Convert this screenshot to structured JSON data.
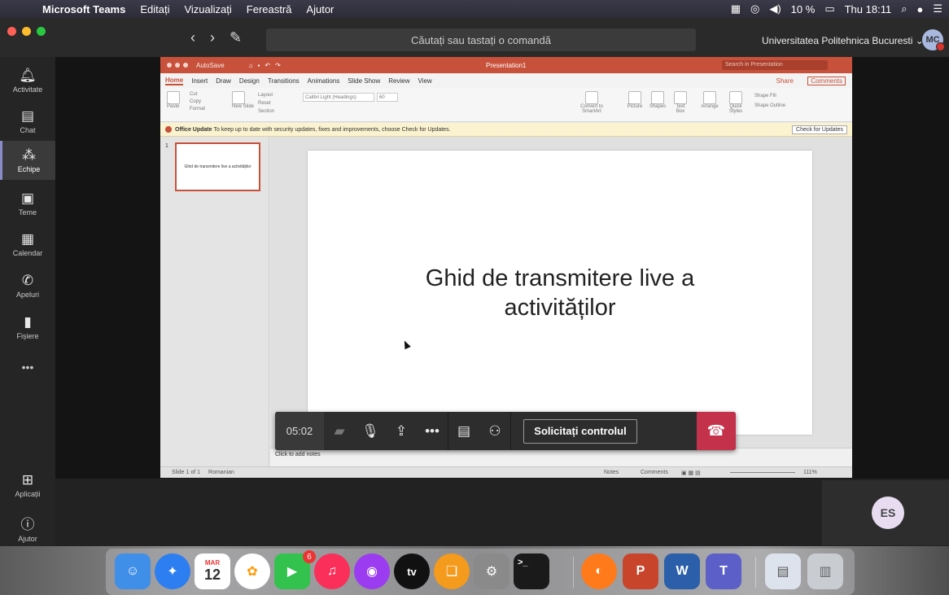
{
  "menubar": {
    "app": "Microsoft Teams",
    "items": [
      "Editați",
      "Vizualizați",
      "Fereastră",
      "Ajutor"
    ],
    "battery": "10 %",
    "clock": "Thu 18:11"
  },
  "titlebar": {
    "search_placeholder": "Căutați sau tastați o comandă",
    "org": "Universitatea Politehnica Bucuresti ⌄",
    "avatar": "MC"
  },
  "rail": {
    "items": [
      {
        "label": "Activitate",
        "icon": "bell-icon"
      },
      {
        "label": "Chat",
        "icon": "chat-icon"
      },
      {
        "label": "Echipe",
        "icon": "teams-icon"
      },
      {
        "label": "Teme",
        "icon": "assignments-icon"
      },
      {
        "label": "Calendar",
        "icon": "calendar-icon"
      },
      {
        "label": "Apeluri",
        "icon": "phone-icon"
      },
      {
        "label": "Fișiere",
        "icon": "files-icon"
      }
    ],
    "more": "•••",
    "apps": "Aplicații",
    "help": "Ajutor"
  },
  "ppt": {
    "autosave": "AutoSave",
    "title": "Presentation1",
    "search": "Search in Presentation",
    "tabs": [
      "Home",
      "Insert",
      "Draw",
      "Design",
      "Transitions",
      "Animations",
      "Slide Show",
      "Review",
      "View"
    ],
    "share": "Share",
    "comments": "Comments",
    "ribbon": {
      "paste": "Paste",
      "cut": "Cut",
      "copy": "Copy",
      "format": "Format",
      "new_slide": "New Slide",
      "layout": "Layout",
      "reset": "Reset",
      "section": "Section",
      "font": "Calibri Light (Headings)",
      "font_size": "60",
      "convert": "Convert to SmartArt",
      "picture": "Picture",
      "shapes": "Shapes",
      "textbox": "Text Box",
      "arrange": "Arrange",
      "quick_styles": "Quick Styles",
      "shape_fill": "Shape Fill",
      "shape_outline": "Shape Outline"
    },
    "update_title": "Office Update",
    "update_text": "To keep up to date with security updates, fixes and improvements, choose Check for Updates.",
    "update_btn": "Check for Updates",
    "thumb_num": "1",
    "thumb_text": "Ghid de transmitere live a activităților",
    "slide_title": "Ghid de transmitere live a activităților",
    "notes": "Click to add notes",
    "status_slide": "Slide 1 of 1",
    "status_lang": "Romanian",
    "status_notes": "Notes",
    "status_comments": "Comments",
    "zoom": "111%"
  },
  "controls": {
    "timer": "05:02",
    "request": "Solicitați controlul"
  },
  "participant": {
    "initials": "ES"
  },
  "dock": {
    "calendar_month": "MAR",
    "calendar_day": "12",
    "facetime_badge": "6",
    "appletv": "tv"
  }
}
